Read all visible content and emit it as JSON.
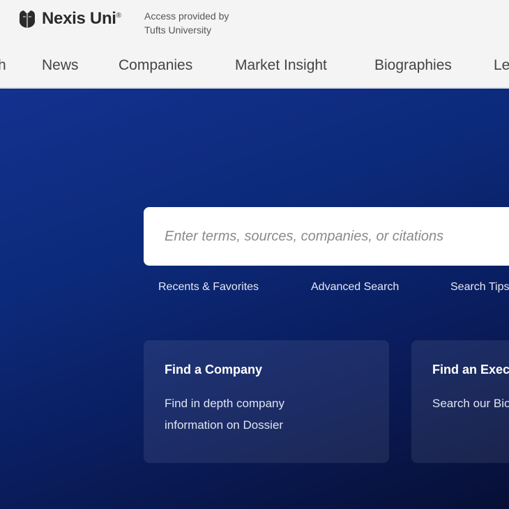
{
  "header": {
    "brand_name": "Nexis Uni",
    "brand_mark": "®",
    "access_line1": "Access provided by",
    "access_line2": "Tufts University"
  },
  "nav": {
    "items": [
      {
        "label": "h"
      },
      {
        "label": "News"
      },
      {
        "label": "Companies"
      },
      {
        "label": "Market Insight"
      },
      {
        "label": "Biographies"
      },
      {
        "label": "Le"
      }
    ]
  },
  "search": {
    "placeholder": "Enter terms, sources, companies, or citations",
    "links": [
      {
        "label": "Recents & Favorites"
      },
      {
        "label": "Advanced Search"
      },
      {
        "label": "Search Tips"
      }
    ]
  },
  "cards": [
    {
      "title": "Find a Company",
      "description": "Find in depth company information on Dossier"
    },
    {
      "title": "Find an Executive",
      "description": "Search our Biographies"
    }
  ],
  "colors": {
    "hero_top": "#14318f",
    "hero_bottom": "#070f35",
    "header_bg": "#f4f4f4"
  }
}
